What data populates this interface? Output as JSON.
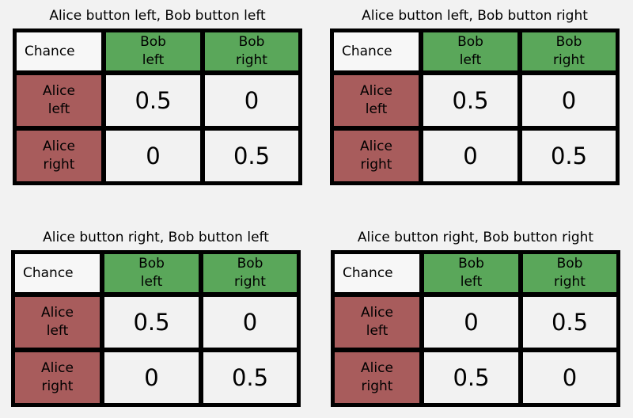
{
  "colors": {
    "background": "#f2f2f2",
    "column_header": "#5aa75a",
    "row_header": "#a85c5c",
    "border": "#000000"
  },
  "tables": [
    {
      "title": "Alice button left, Bob button left",
      "corner": "Chance",
      "col_headers": [
        [
          "Bob",
          "left"
        ],
        [
          "Bob",
          "right"
        ]
      ],
      "row_headers": [
        [
          "Alice",
          "left"
        ],
        [
          "Alice",
          "right"
        ]
      ],
      "values": [
        [
          "0.5",
          "0"
        ],
        [
          "0",
          "0.5"
        ]
      ]
    },
    {
      "title": "Alice button left, Bob button right",
      "corner": "Chance",
      "col_headers": [
        [
          "Bob",
          "left"
        ],
        [
          "Bob",
          "right"
        ]
      ],
      "row_headers": [
        [
          "Alice",
          "left"
        ],
        [
          "Alice",
          "right"
        ]
      ],
      "values": [
        [
          "0.5",
          "0"
        ],
        [
          "0",
          "0.5"
        ]
      ]
    },
    {
      "title": "Alice button right, Bob button left",
      "corner": "Chance",
      "col_headers": [
        [
          "Bob",
          "left"
        ],
        [
          "Bob",
          "right"
        ]
      ],
      "row_headers": [
        [
          "Alice",
          "left"
        ],
        [
          "Alice",
          "right"
        ]
      ],
      "values": [
        [
          "0.5",
          "0"
        ],
        [
          "0",
          "0.5"
        ]
      ]
    },
    {
      "title": "Alice button right, Bob button right",
      "corner": "Chance",
      "col_headers": [
        [
          "Bob",
          "left"
        ],
        [
          "Bob",
          "right"
        ]
      ],
      "row_headers": [
        [
          "Alice",
          "left"
        ],
        [
          "Alice",
          "right"
        ]
      ],
      "values": [
        [
          "0",
          "0.5"
        ],
        [
          "0.5",
          "0"
        ]
      ]
    }
  ]
}
